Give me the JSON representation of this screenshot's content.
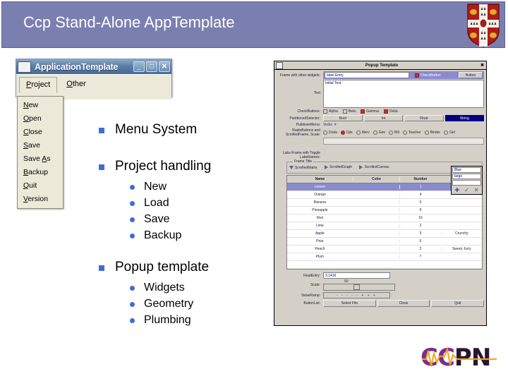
{
  "header": {
    "title": "Ccp Stand-Alone AppTemplate",
    "crest_name": "cambridge-coat-of-arms",
    "bg_color": "#7b7fb0"
  },
  "app_window": {
    "title": "ApplicationTemplate",
    "icon_name": "app-icon",
    "window_buttons": [
      {
        "name": "minimize-button",
        "glyph": "_"
      },
      {
        "name": "maximize-button",
        "glyph": "□"
      },
      {
        "name": "close-button",
        "glyph": "✕"
      }
    ],
    "menubar": [
      {
        "name": "menubar-tab-project",
        "mnemonic": "P",
        "rest": "roject",
        "active": true
      },
      {
        "name": "menubar-tab-other",
        "mnemonic": "O",
        "rest": "ther",
        "active": false
      }
    ],
    "project_menu": [
      {
        "mnemonic": "N",
        "rest": "ew"
      },
      {
        "mnemonic": "O",
        "rest": "pen"
      },
      {
        "mnemonic": "C",
        "rest": "lose"
      },
      {
        "mnemonic": "S",
        "rest": "ave"
      },
      {
        "pre": "Save ",
        "mnemonic": "A",
        "rest": "s"
      },
      {
        "mnemonic": "B",
        "rest": "ackup"
      },
      {
        "mnemonic": "Q",
        "rest": "uit"
      },
      {
        "mnemonic": "V",
        "rest": "ersion"
      }
    ]
  },
  "bullets": {
    "marker_color": "#3b6fd4",
    "items": [
      {
        "label": "Menu System",
        "children": []
      },
      {
        "label": "Project handling",
        "children": [
          "New",
          "Load",
          "Save",
          "Backup"
        ]
      },
      {
        "label": "Popup template",
        "children": [
          "Widgets",
          "Geometry",
          "Plumbing"
        ]
      }
    ]
  },
  "popup_template": {
    "title": "Popup Template",
    "close_glyph": "✖",
    "rows": {
      "frame_widgets_label": "Frame with other widgets:",
      "entry_label": "label",
      "entry_value": "Entry",
      "checkbutton_inline": "CheckButton",
      "button_label": "Button",
      "text_label": "Text",
      "text_value": "Initial Text.",
      "checkbuttons_label": "CheckButtons:",
      "checkbuttons": [
        {
          "label": "Alpha",
          "checked": false
        },
        {
          "label": "Beta",
          "checked": false
        },
        {
          "label": "Gamma",
          "checked": true
        },
        {
          "label": "Delta",
          "checked": true
        }
      ],
      "partitioned_label": "PartitionedSelector:",
      "partitioned": [
        {
          "label": "Bool",
          "selected": false
        },
        {
          "label": "Int",
          "selected": false
        },
        {
          "label": "Float",
          "selected": false
        },
        {
          "label": "String",
          "selected": true
        }
      ],
      "pulldown_label": "PulldownMenu:",
      "pulldown_value": "Verbs",
      "pulldown_arrow": "▼",
      "radiobuttons_label": "RadioButtons and ScrolledFrame, Scale:",
      "radiobuttons": [
        {
          "label": "Doda",
          "selected": false
        },
        {
          "label": "Djin",
          "selected": true
        },
        {
          "label": "Merv",
          "selected": false
        },
        {
          "label": "Gee",
          "selected": false
        },
        {
          "label": "Bill",
          "selected": false
        },
        {
          "label": "Teacher",
          "selected": false
        },
        {
          "label": "Binder",
          "selected": false
        },
        {
          "label": "Girl",
          "selected": false
        }
      ],
      "frame_label": "Labs Frame with Toggle Labelframes:",
      "frame_title": "Frame Title",
      "toggles": [
        {
          "label": "ScrolledMatrix",
          "open": true
        },
        {
          "label": "ScrolledGraph",
          "open": false
        },
        {
          "label": "ScrolledCanvas",
          "open": false
        }
      ],
      "float_entry_label": "FloatEntry:",
      "float_entry_value": "3.1416",
      "scale_label": "Scale:",
      "scale_value": "50",
      "value_ramp_label": "ValueRamp:",
      "value_ramp_glyphs": "- - - - - + + +",
      "buttonlist_label": "ButtonList:",
      "buttons": [
        "Select File",
        "Close",
        "Quit"
      ]
    },
    "table": {
      "columns": [
        "Name",
        "Color",
        "Number",
        ""
      ],
      "rows": [
        {
          "name": "Lemon",
          "color": "",
          "number": "1",
          "note": "",
          "selected": true
        },
        {
          "name": "Orange",
          "color": "",
          "number": "4",
          "note": "",
          "selected": false
        },
        {
          "name": "Banana",
          "color": "",
          "number": "5",
          "note": "",
          "selected": false
        },
        {
          "name": "Pineapple",
          "color": "",
          "number": "9",
          "note": "",
          "selected": false
        },
        {
          "name": "Kiwi",
          "color": "",
          "number": "16",
          "note": "",
          "selected": false
        },
        {
          "name": "Lime",
          "color": "",
          "number": "2",
          "note": "",
          "selected": false
        },
        {
          "name": "Apple",
          "color": "",
          "number": "5",
          "note": "Crunchy",
          "selected": false
        },
        {
          "name": "Pear",
          "color": "",
          "number": "6",
          "note": "",
          "selected": false
        },
        {
          "name": "Peach",
          "color": "",
          "number": "2",
          "note": "Sweet, furry",
          "selected": false
        },
        {
          "name": "Plum",
          "color": "",
          "number": "7",
          "note": "",
          "selected": false
        }
      ]
    },
    "mini_editor": {
      "field1": "Blue",
      "field2": "large",
      "field3": "",
      "buttons": [
        {
          "name": "add-icon",
          "glyph": "✚"
        },
        {
          "name": "confirm-icon",
          "glyph": "✓"
        },
        {
          "name": "cancel-icon",
          "glyph": "✕"
        }
      ]
    }
  },
  "logo": {
    "part1": "CC",
    "part2": "PN",
    "color1": "#7a2f8f",
    "color2": "#2a1630"
  }
}
